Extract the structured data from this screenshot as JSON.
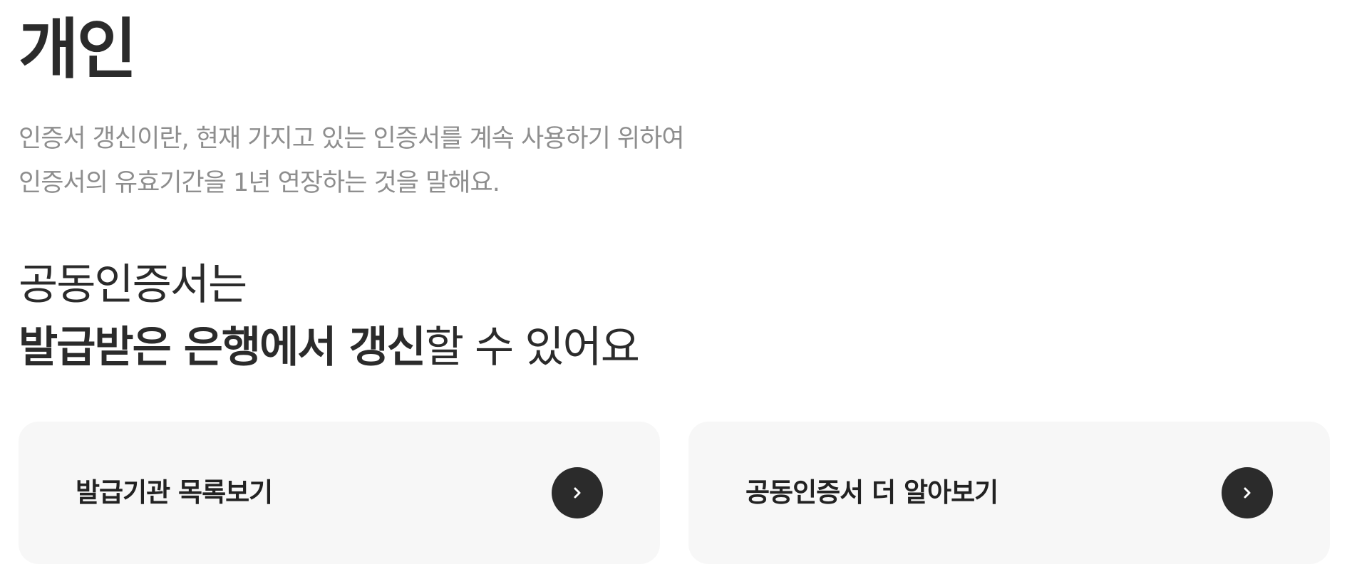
{
  "header": {
    "title": "개인"
  },
  "description": {
    "line1": "인증서 갱신이란, 현재 가지고 있는 인증서를 계속 사용하기 위하여",
    "line2": "인증서의 유효기간을 1년 연장하는 것을 말해요."
  },
  "headline": {
    "line1": "공동인증서는",
    "line2_bold": "발급받은 은행에서 갱신",
    "line2_regular": "할 수 있어요"
  },
  "cards": [
    {
      "label": "발급기관 목록보기",
      "icon": "chevron-right-icon"
    },
    {
      "label": "공동인증서 더 알아보기",
      "icon": "chevron-right-icon"
    }
  ],
  "colors": {
    "title": "#2b2b2b",
    "description": "#8e8e8e",
    "card_background": "#f7f7f7",
    "arrow_button": "#2b2b2b",
    "arrow_icon": "#ffffff"
  }
}
